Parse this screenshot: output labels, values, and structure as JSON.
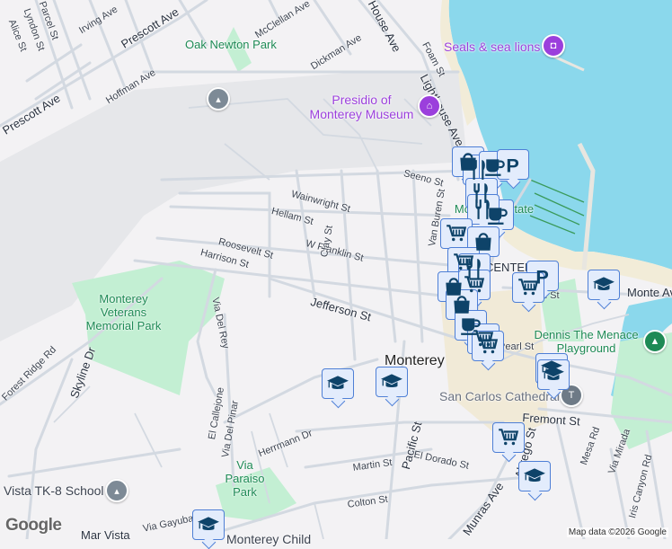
{
  "map": {
    "streets": [
      "Parcel St",
      "Lyndon St",
      "Alice St",
      "Irving Ave",
      "Prescott Ave",
      "Prescott Ave",
      "McClellan Ave",
      "Dickman Ave",
      "Hoffman Ave",
      "Seeno St",
      "Wainwright St",
      "Hellam St",
      "Roosevelt St",
      "Harrison St",
      "W Franklin St",
      "Clay St",
      "Jefferson St",
      "Van Buren St",
      "Lighthouse Ave",
      "Foam St",
      "House Ave",
      "Pacific St",
      "El Dorado St",
      "Martin St",
      "Colton St",
      "Munras Ave",
      "Abrego St",
      "Fremont St",
      "Mesa Rd",
      "Via Mirada",
      "Iris Canyon Rd",
      "Via Del Rey",
      "El Callejone",
      "Via Del Pinar",
      "Herrmann Dr",
      "Skyline Dr",
      "Forest Ridge Rd",
      "Via Gayuba",
      "Mar Vista",
      "Monte Ave",
      "Pearl St",
      "Franklin St"
    ],
    "parks": [
      "Oak Newton Park",
      "Monterey Veterans Memorial Park",
      "Via Paraiso Park",
      "Dennis The Menace Playground",
      "Monterey State Park"
    ],
    "pois": [
      "Presidio of Monterey Museum",
      "Seals & sea lions",
      "San Carlos Cathedral",
      "Vista TK-8 School",
      "Monterey Child"
    ],
    "city": "Monterey",
    "district": "CENTER",
    "credit": "Map data ©2026 Google",
    "logo": "Google"
  },
  "colors": {
    "water": "#8bd8ec",
    "park": "#c3efd3",
    "marker_bg": "#e3ecfc",
    "marker_border": "#4e7fd6",
    "marker_icon": "#0e4369",
    "poi": "#9b3fdc"
  },
  "markers": [
    "shopping-bag",
    "restaurant",
    "coffee",
    "parking",
    "restaurant",
    "coffee",
    "restaurant",
    "shopping-cart",
    "shopping-bag",
    "shopping-cart",
    "restaurant",
    "shopping-bag",
    "shopping-cart",
    "parking",
    "shopping-cart",
    "school",
    "shopping-bag",
    "coffee",
    "shopping-cart",
    "shopping-cart",
    "school",
    "school",
    "shopping-cart",
    "school",
    "school",
    "school",
    "school"
  ]
}
